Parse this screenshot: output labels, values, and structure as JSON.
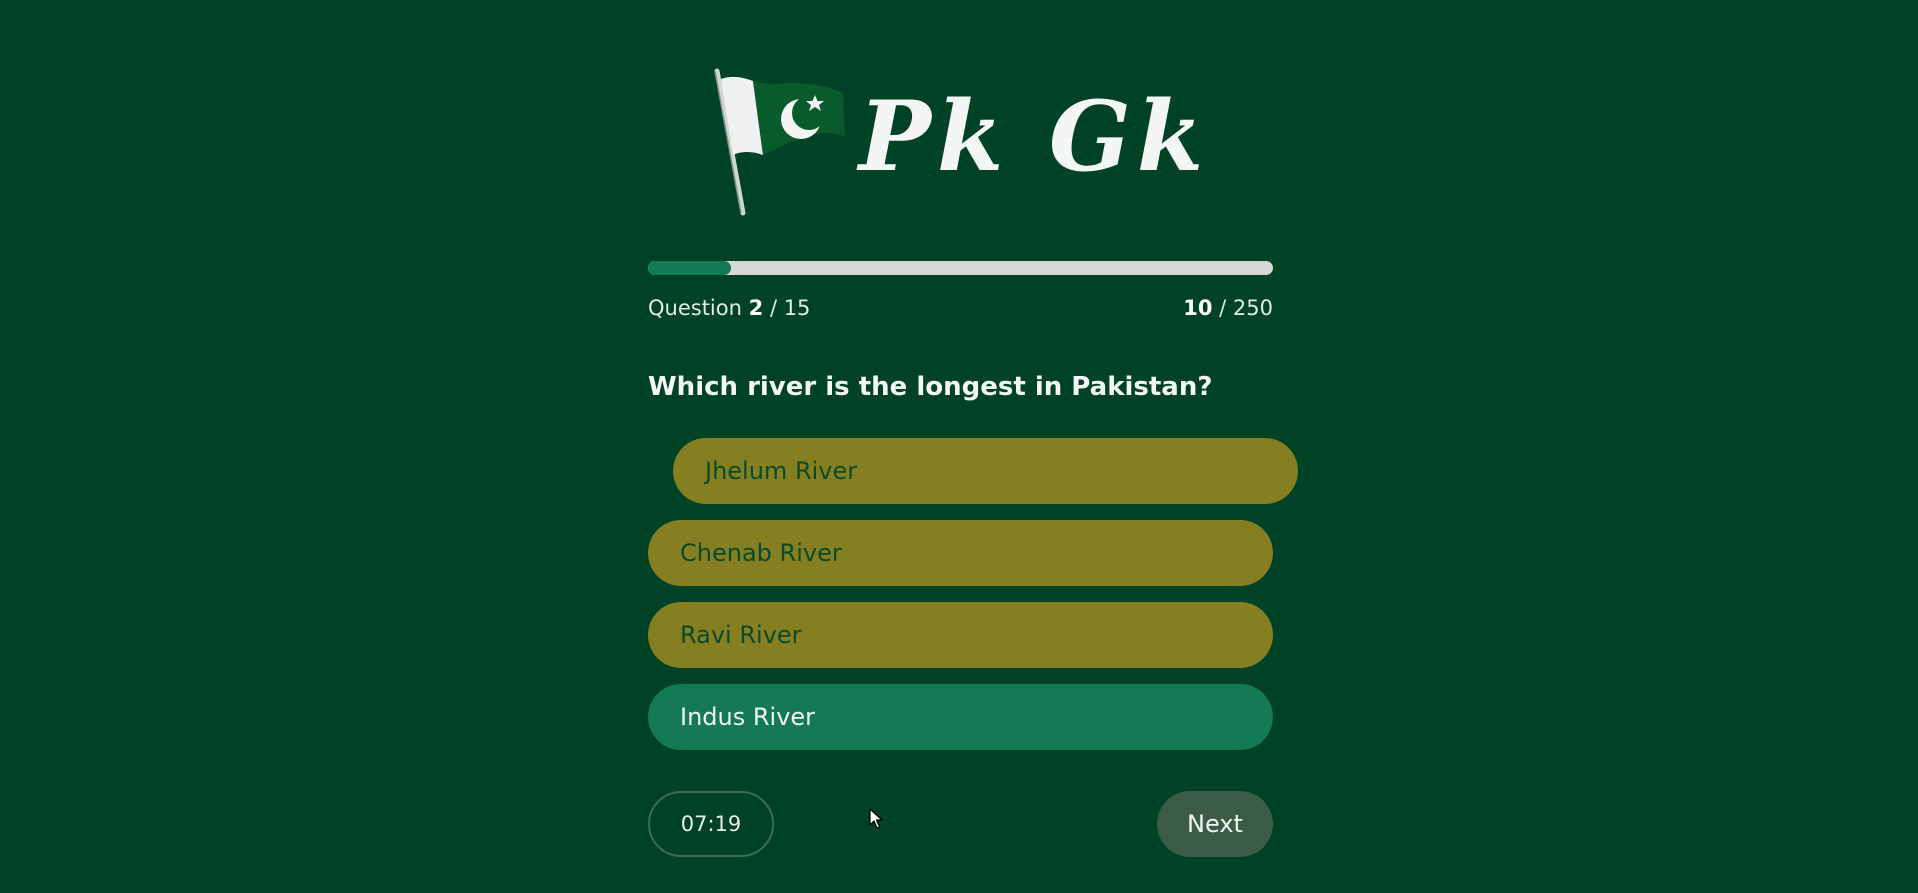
{
  "header": {
    "title": "Pk Gk",
    "flag_icon": "pakistan-flag-icon"
  },
  "progress": {
    "fraction": 0.133,
    "question_label": "Question",
    "question_current": "2",
    "question_total_text": "/ 15",
    "score_current": "10",
    "score_total_text": "/ 250"
  },
  "question": {
    "text": "Which river is the longest in Pakistan?"
  },
  "options": [
    {
      "label": "Jhelum River",
      "state": "default"
    },
    {
      "label": "Chenab River",
      "state": "default"
    },
    {
      "label": "Ravi River",
      "state": "default"
    },
    {
      "label": "Indus River",
      "state": "correct"
    }
  ],
  "footer": {
    "timer": "07:19",
    "next_label": "Next"
  },
  "colors": {
    "background": "#004225",
    "option_default": "#867f22",
    "option_correct": "#137a55",
    "progress_fill": "#137a55",
    "progress_track": "#d5d8d7",
    "next_button": "#3d5c48"
  }
}
